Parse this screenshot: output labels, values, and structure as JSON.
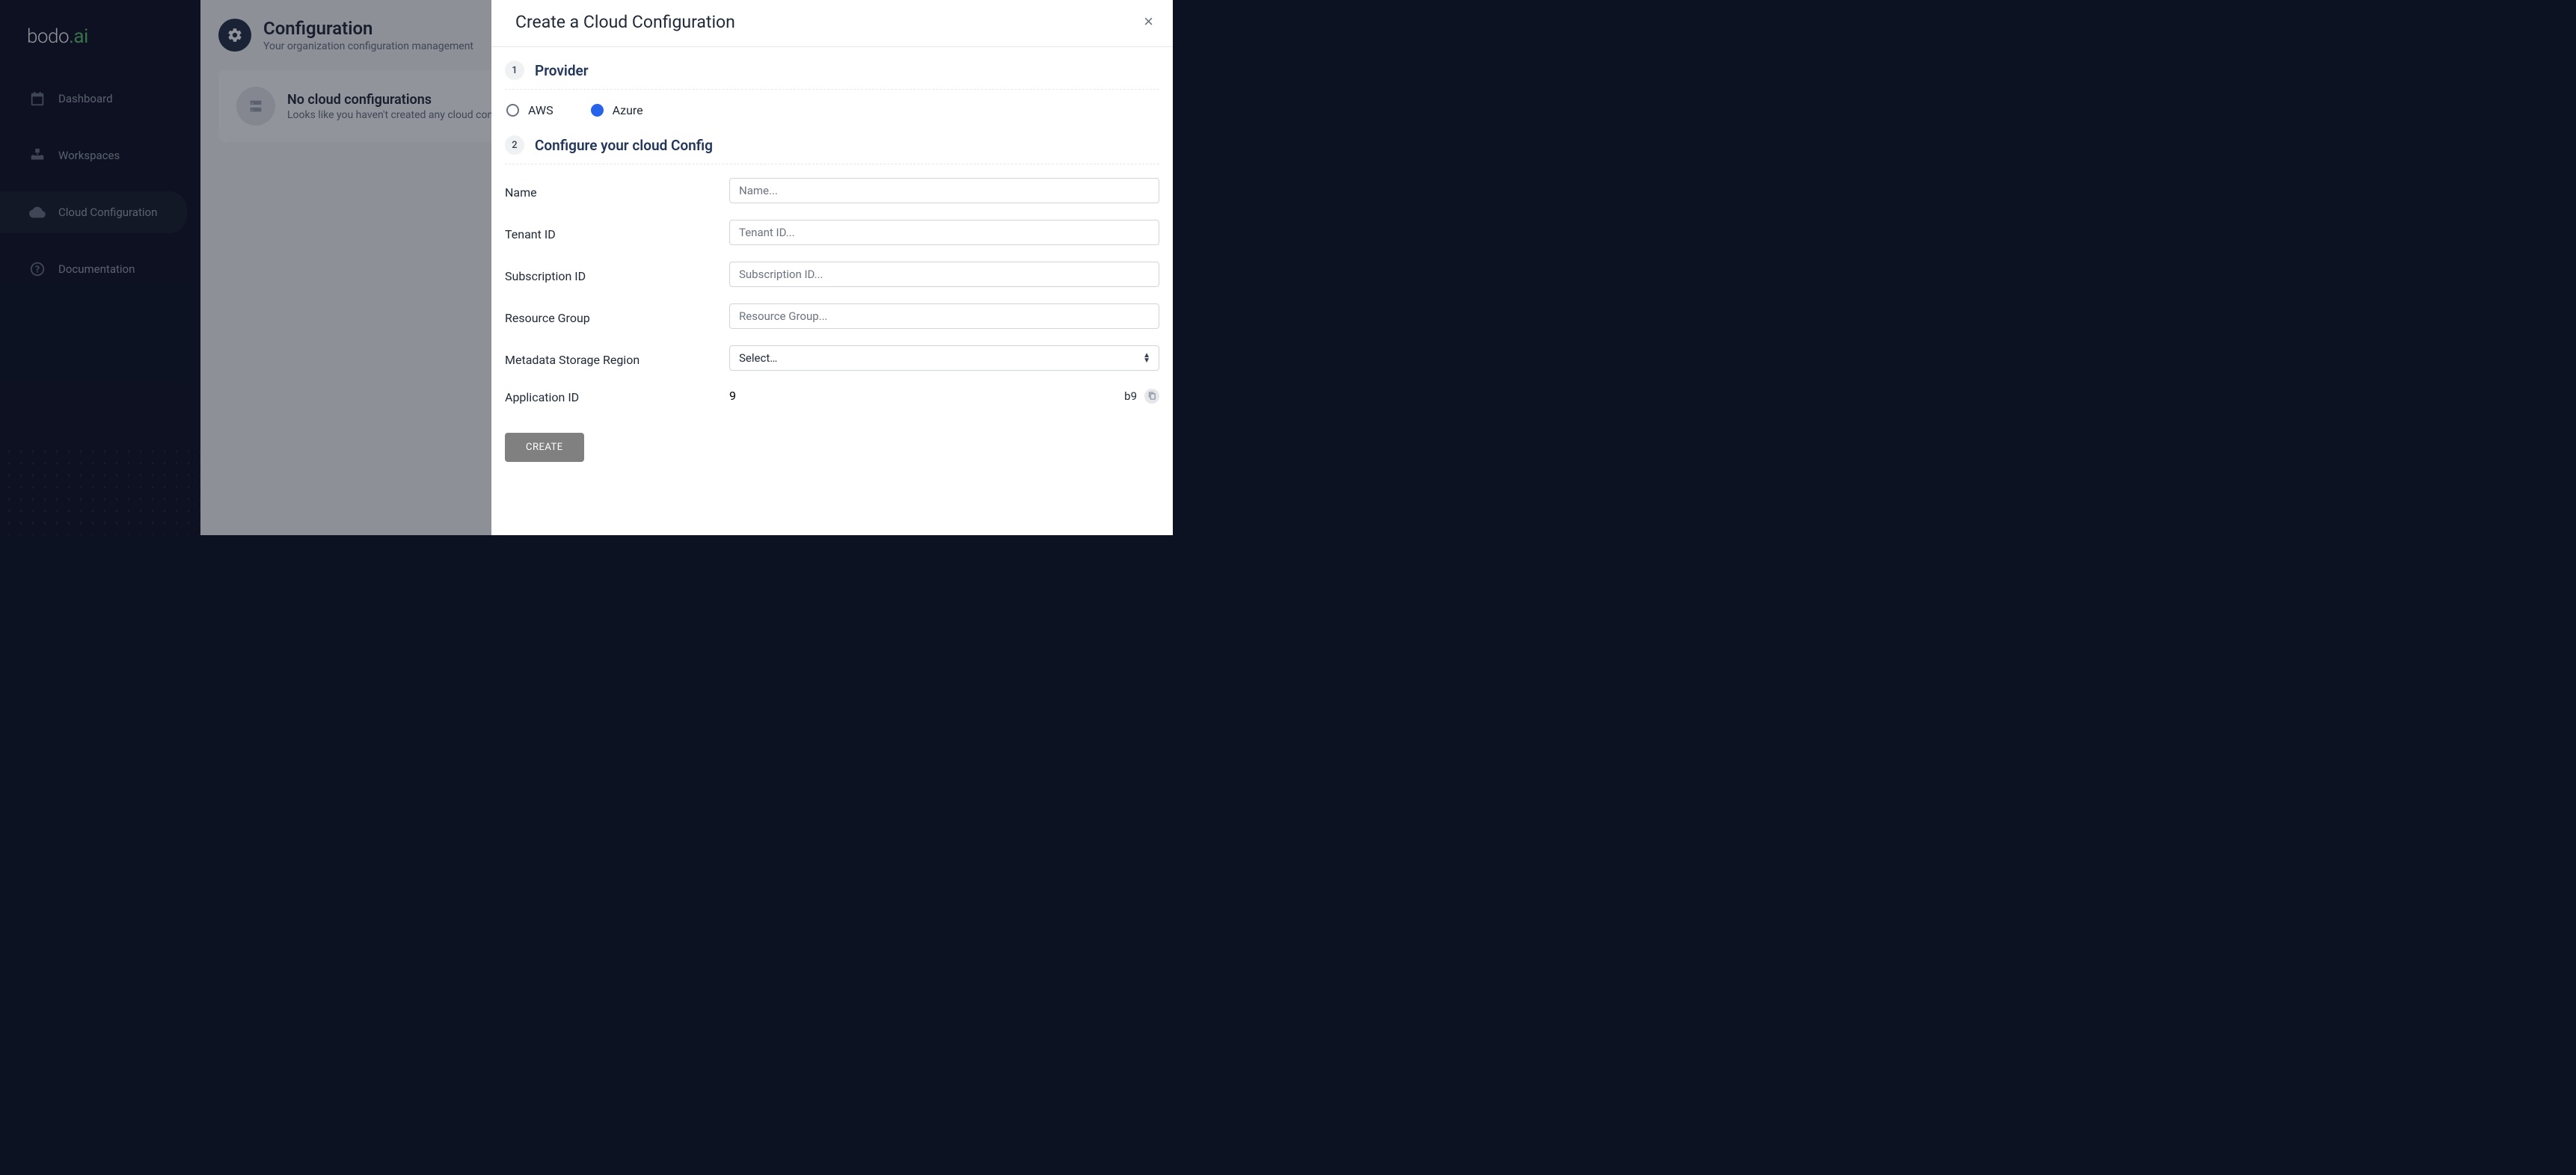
{
  "logo": {
    "base": "bodo",
    "accent": ".ai"
  },
  "sidebar": {
    "items": [
      {
        "label": "Dashboard"
      },
      {
        "label": "Workspaces"
      },
      {
        "label": "Cloud Configuration"
      },
      {
        "label": "Documentation"
      }
    ]
  },
  "page": {
    "title": "Configuration",
    "subtitle": "Your organization configuration management"
  },
  "empty": {
    "title": "No cloud configurations",
    "subtitle": "Looks like you haven't created any cloud con"
  },
  "panel": {
    "title": "Create a Cloud Configuration",
    "step1": {
      "number": "1",
      "title": "Provider",
      "options": {
        "aws": "AWS",
        "azure": "Azure"
      },
      "selected": "azure"
    },
    "step2": {
      "number": "2",
      "title": "Configure your cloud Config",
      "fields": {
        "name": {
          "label": "Name",
          "placeholder": "Name..."
        },
        "tenant": {
          "label": "Tenant ID",
          "placeholder": "Tenant ID..."
        },
        "subscription": {
          "label": "Subscription ID",
          "placeholder": "Subscription ID..."
        },
        "resource": {
          "label": "Resource Group",
          "placeholder": "Resource Group..."
        },
        "region": {
          "label": "Metadata Storage Region",
          "placeholder": "Select…"
        },
        "appid": {
          "label": "Application ID",
          "value_left": "9",
          "value_right": "b9"
        }
      }
    },
    "create_label": "CREATE"
  }
}
